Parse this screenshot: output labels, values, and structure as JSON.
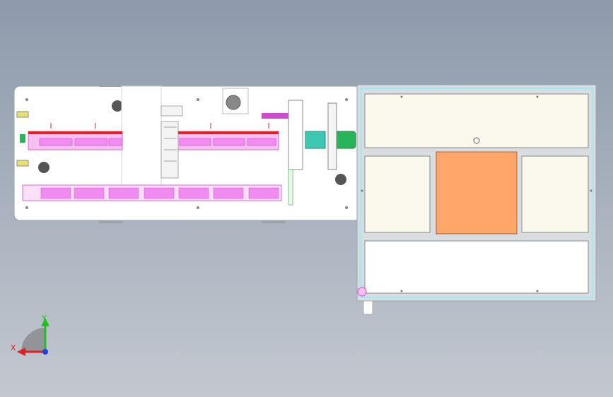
{
  "viewport": {
    "background_top": "#8e9aab",
    "background_bottom": "#c3c8d0"
  },
  "model": {
    "colors": {
      "panel": "#ffffff",
      "panel_edge": "#9aa3ad",
      "pink": "#f08cf0",
      "pink_dark": "#d04ad0",
      "red": "#e8202a",
      "green": "#28b45a",
      "teal": "#3ec8b4",
      "cream": "#fbf8ee",
      "orange": "#ffa66b",
      "frame": "#d9dde2",
      "cyan": "#aee6ee",
      "dark": "#555555"
    }
  },
  "triad": {
    "x_label": "X",
    "y_label": "Y",
    "x_color": "#e02020",
    "y_color": "#20c020",
    "z_color": "#2040e0"
  }
}
